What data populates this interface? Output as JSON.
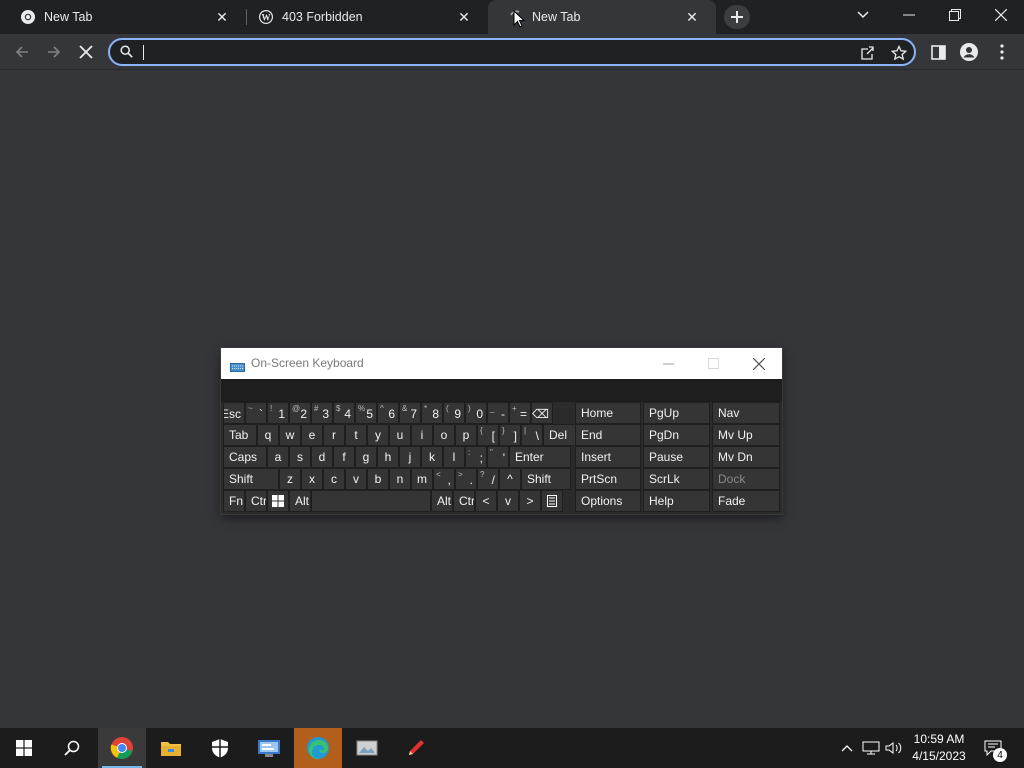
{
  "browser": {
    "tabs": [
      {
        "title": "New Tab",
        "icon": "chrome-icon"
      },
      {
        "title": "403 Forbidden",
        "icon": "wordpress-icon"
      },
      {
        "title": "New Tab",
        "icon": "loading-spinner-icon",
        "active": true
      }
    ],
    "omnibox": {
      "value": "",
      "placeholder": ""
    },
    "colors": {
      "frame": "#202124",
      "toolbar": "#35363a",
      "focus_ring": "#8ab4f8",
      "page": "#35363a"
    }
  },
  "osk": {
    "title": "On-Screen Keyboard",
    "rows": [
      [
        {
          "sh": "",
          "mn": "Esc",
          "type": "esc"
        },
        {
          "sh": "~",
          "mn": "`"
        },
        {
          "sh": "!",
          "mn": "1"
        },
        {
          "sh": "@",
          "mn": "2"
        },
        {
          "sh": "#",
          "mn": "3"
        },
        {
          "sh": "$",
          "mn": "4"
        },
        {
          "sh": "%",
          "mn": "5"
        },
        {
          "sh": "^",
          "mn": "6"
        },
        {
          "sh": "&",
          "mn": "7"
        },
        {
          "sh": "*",
          "mn": "8"
        },
        {
          "sh": "(",
          "mn": "9"
        },
        {
          "sh": ")",
          "mn": "0"
        },
        {
          "sh": "_",
          "mn": "-"
        },
        {
          "sh": "+",
          "mn": "="
        },
        {
          "sh": "",
          "mn": "⌫",
          "type": "bksp"
        }
      ],
      [
        "Tab",
        "q",
        "w",
        "e",
        "r",
        "t",
        "y",
        "u",
        "i",
        "o",
        "p",
        {
          "sh": "{",
          "mn": "["
        },
        {
          "sh": "}",
          "mn": "]"
        },
        {
          "sh": "|",
          "mn": "\\"
        },
        "Del"
      ],
      [
        "Caps",
        "a",
        "s",
        "d",
        "f",
        "g",
        "h",
        "j",
        "k",
        "l",
        {
          "sh": ":",
          "mn": ";"
        },
        {
          "sh": "\"",
          "mn": "'"
        },
        "Enter"
      ],
      [
        "Shift",
        "z",
        "x",
        "c",
        "v",
        "b",
        "n",
        "m",
        {
          "sh": "<",
          "mn": ","
        },
        {
          "sh": ">",
          "mn": "."
        },
        {
          "sh": "?",
          "mn": "/"
        },
        "^",
        "Shift"
      ],
      [
        "Fn",
        "Ctrl",
        "win",
        "Alt",
        "space",
        "Alt",
        "Ctrl",
        "<",
        "v",
        ">",
        "menu"
      ]
    ],
    "nav": [
      [
        "Home",
        "PgUp",
        "Nav"
      ],
      [
        "End",
        "PgDn",
        "Mv Up"
      ],
      [
        "Insert",
        "Pause",
        "Mv Dn"
      ],
      [
        "PrtScn",
        "ScrLk",
        "Dock"
      ],
      [
        "Options",
        "Help",
        "Fade"
      ]
    ]
  },
  "taskbar": {
    "apps": [
      "start-icon",
      "search-icon",
      "chrome-icon",
      "file-explorer-icon",
      "windows-security-icon",
      "control-panel-icon",
      "edge-icon",
      "photos-icon",
      "pen-app-icon"
    ],
    "clock": {
      "time": "10:59 AM",
      "date": "4/15/2023"
    },
    "notifications": "4"
  }
}
